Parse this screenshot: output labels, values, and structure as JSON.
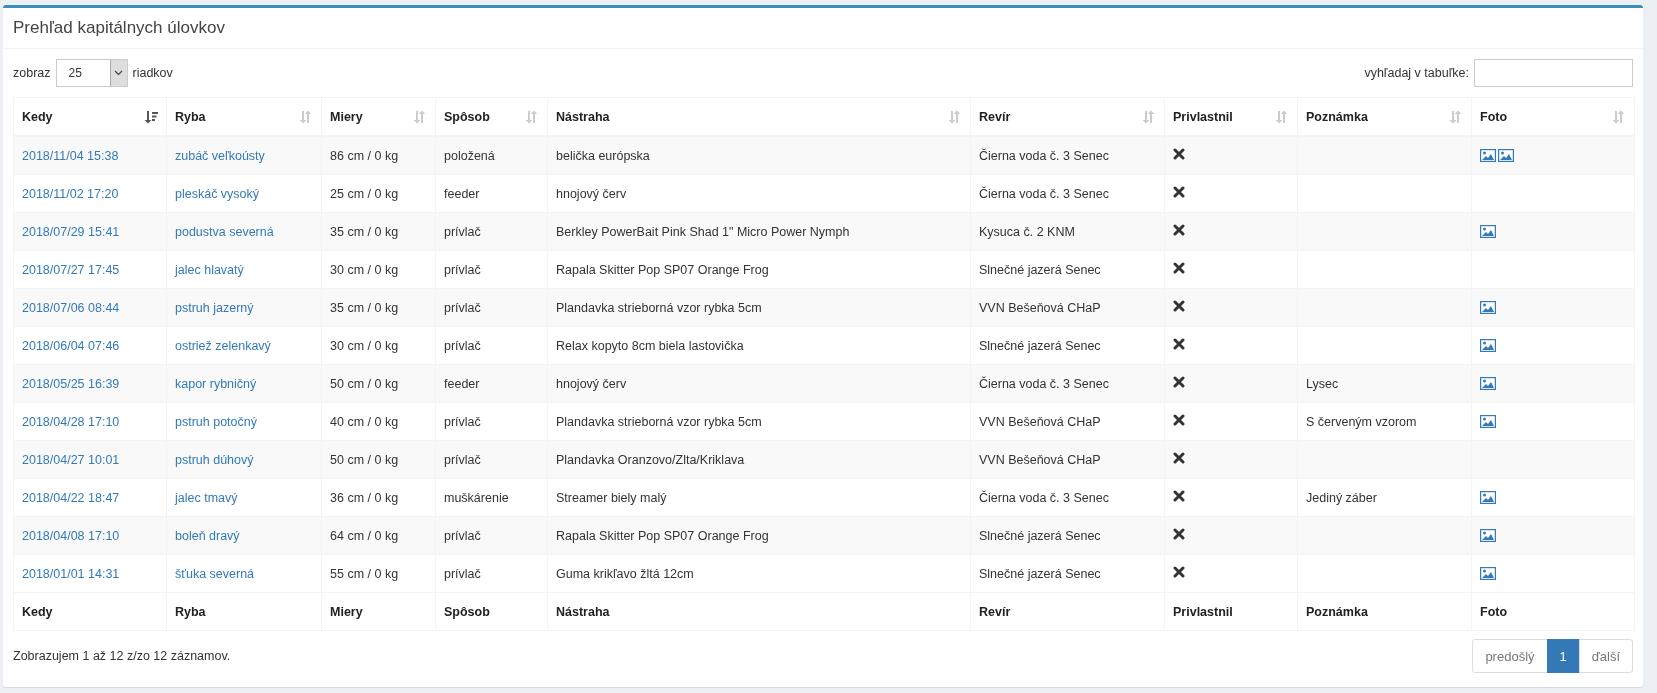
{
  "panel": {
    "title": "Prehľad kapitálnych úlovkov"
  },
  "length_control": {
    "label_before": "zobraz",
    "value": "25",
    "label_after": "riadkov"
  },
  "search": {
    "label": "vyhľadaj v tabuľke:"
  },
  "table": {
    "columns": [
      {
        "label": "Kedy",
        "sorted": true
      },
      {
        "label": "Ryba",
        "sorted": false
      },
      {
        "label": "Miery",
        "sorted": false
      },
      {
        "label": "Spôsob",
        "sorted": false
      },
      {
        "label": "Nástraha",
        "sorted": false
      },
      {
        "label": "Revír",
        "sorted": false
      },
      {
        "label": "Privlastnil",
        "sorted": false
      },
      {
        "label": "Poznámka",
        "sorted": false
      },
      {
        "label": "Foto",
        "sorted": false
      }
    ],
    "rows": [
      {
        "date": "2018/11/04 15:38",
        "fish": "zubáč veľkoústy",
        "size": "86 cm / 0 kg",
        "method": "položená",
        "bait": "belička európska",
        "water": "Čierna voda č. 3 Senec",
        "kept": false,
        "note": "",
        "photos": [
          {
            "kind": "image"
          },
          {
            "kind": "image"
          }
        ]
      },
      {
        "date": "2018/11/02 17:20",
        "fish": "pleskáč vysoký",
        "size": "25 cm / 0 kg",
        "method": "feeder",
        "bait": "hnojový červ",
        "water": "Čierna voda č. 3 Senec",
        "kept": false,
        "note": "",
        "photos": []
      },
      {
        "date": "2018/07/29 15:41",
        "fish": "podustva severná",
        "size": "35 cm / 0 kg",
        "method": "prívlač",
        "bait": "Berkley PowerBait Pink Shad 1\" Micro Power Nymph",
        "water": "Kysuca č. 2 KNM",
        "kept": false,
        "note": "",
        "photos": [
          {
            "kind": "image"
          }
        ]
      },
      {
        "date": "2018/07/27 17:45",
        "fish": "jalec hlavatý",
        "size": "30 cm / 0 kg",
        "method": "prívlač",
        "bait": "Rapala Skitter Pop SP07 Orange Frog",
        "water": "Slnečné jazerá Senec",
        "kept": false,
        "note": "",
        "photos": []
      },
      {
        "date": "2018/07/06 08:44",
        "fish": "pstruh jazerný",
        "size": "35 cm / 0 kg",
        "method": "prívlač",
        "bait": "Plandavka strieborná vzor rybka 5cm",
        "water": "VVN Bešeňová CHaP",
        "kept": false,
        "note": "",
        "photos": [
          {
            "kind": "image"
          }
        ]
      },
      {
        "date": "2018/06/04 07:46",
        "fish": "ostriež zelenkavý",
        "size": "30 cm / 0 kg",
        "method": "prívlač",
        "bait": "Relax kopyto 8cm biela lastovička",
        "water": "Slnečné jazerá Senec",
        "kept": false,
        "note": "",
        "photos": [
          {
            "kind": "image"
          }
        ]
      },
      {
        "date": "2018/05/25 16:39",
        "fish": "kapor rybničný",
        "size": "50 cm / 0 kg",
        "method": "feeder",
        "bait": "hnojový červ",
        "water": "Čierna voda č. 3 Senec",
        "kept": false,
        "note": "Lysec",
        "photos": [
          {
            "kind": "image"
          }
        ]
      },
      {
        "date": "2018/04/28 17:10",
        "fish": "pstruh potočný",
        "size": "40 cm / 0 kg",
        "method": "prívlač",
        "bait": "Plandavka strieborná vzor rybka 5cm",
        "water": "VVN Bešeňová CHaP",
        "kept": false,
        "note": "S červeným vzorom",
        "photos": [
          {
            "kind": "image"
          }
        ]
      },
      {
        "date": "2018/04/27 10:01",
        "fish": "pstruh dúhový",
        "size": "50 cm / 0 kg",
        "method": "prívlač",
        "bait": "Plandavka Oranzovo/Zlta/Kriklava",
        "water": "VVN Bešeňová CHaP",
        "kept": false,
        "note": "",
        "photos": []
      },
      {
        "date": "2018/04/22 18:47",
        "fish": "jalec tmavý",
        "size": "36 cm / 0 kg",
        "method": "muškárenie",
        "bait": "Streamer biely malý",
        "water": "Čierna voda č. 3 Senec",
        "kept": false,
        "note": "Jediný záber",
        "photos": [
          {
            "kind": "image"
          }
        ]
      },
      {
        "date": "2018/04/08 17:10",
        "fish": "boleň dravý",
        "size": "64 cm / 0 kg",
        "method": "prívlač",
        "bait": "Rapala Skitter Pop SP07 Orange Frog",
        "water": "Slnečné jazerá Senec",
        "kept": false,
        "note": "",
        "photos": [
          {
            "kind": "image"
          }
        ]
      },
      {
        "date": "2018/01/01 14:31",
        "fish": "šťuka severná",
        "size": "55 cm / 0 kg",
        "method": "prívlač",
        "bait": "Guma krikľavo žltá 12cm",
        "water": "Slnečné jazerá Senec",
        "kept": false,
        "note": "",
        "photos": [
          {
            "kind": "image"
          }
        ]
      }
    ],
    "footer": [
      "Kedy",
      "Ryba",
      "Miery",
      "Spôsob",
      "Nástraha",
      "Revír",
      "Privlastnil",
      "Poznámka",
      "Foto"
    ]
  },
  "info": "Zobrazujem 1 až 12 z/zo 12 záznamov.",
  "pagination": [
    {
      "label": "predošlý",
      "selected": false
    },
    {
      "label": "1",
      "selected": true
    },
    {
      "label": "ďalší",
      "selected": false
    }
  ]
}
